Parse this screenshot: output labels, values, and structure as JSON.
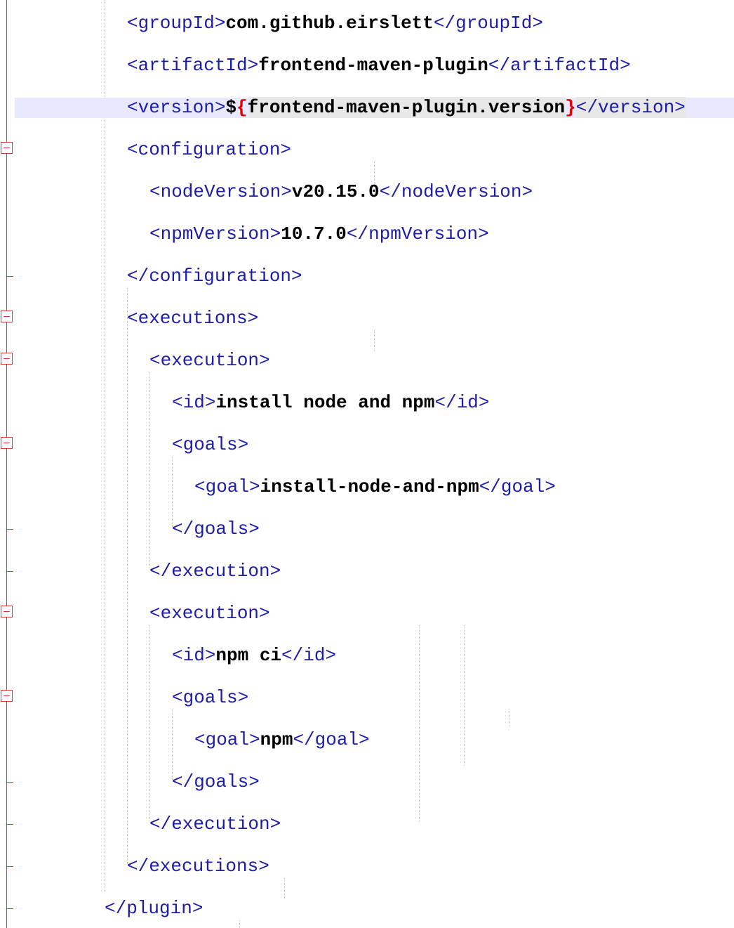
{
  "editor": {
    "lines": [
      {
        "open": "<groupId>",
        "value": "com.github.eirslett",
        "close": "</groupId>"
      },
      {
        "open": "<artifactId>",
        "value": "frontend-maven-plugin",
        "close": "</artifactId>"
      },
      {
        "open": "<version>",
        "value_prefix": "$",
        "brace_open": "{",
        "value": "frontend-maven-plugin.version",
        "brace_close": "}",
        "close": "</version>"
      },
      {
        "open": "<configuration>"
      },
      {
        "open": "<nodeVersion>",
        "value": "v20.15.0",
        "close": "</nodeVersion>"
      },
      {
        "open": "<npmVersion>",
        "value": "10.7.0",
        "close": "</npmVersion>"
      },
      {
        "open": "</configuration>"
      },
      {
        "open": "<executions>"
      },
      {
        "open": "<execution>"
      },
      {
        "open": "<id>",
        "value": "install node and npm",
        "close": "</id>"
      },
      {
        "open": "<goals>"
      },
      {
        "open": "<goal>",
        "value": "install-node-and-npm",
        "close": "</goal>"
      },
      {
        "open": "</goals>"
      },
      {
        "open": "</execution>"
      },
      {
        "open": "<execution>"
      },
      {
        "open": "<id>",
        "value": "npm ci",
        "close": "</id>"
      },
      {
        "open": "<goals>"
      },
      {
        "open": "<goal>",
        "value": "npm",
        "close": "</goal>"
      },
      {
        "open": "</goals>"
      },
      {
        "open": "</execution>"
      },
      {
        "open": "</executions>"
      },
      {
        "open": "</plugin>"
      }
    ]
  },
  "colors": {
    "tag": "#1c1ca8",
    "value": "#000000",
    "brace": "#e00000",
    "current_line": "#e8e8ff",
    "fold_margin": "#d83a3a"
  }
}
